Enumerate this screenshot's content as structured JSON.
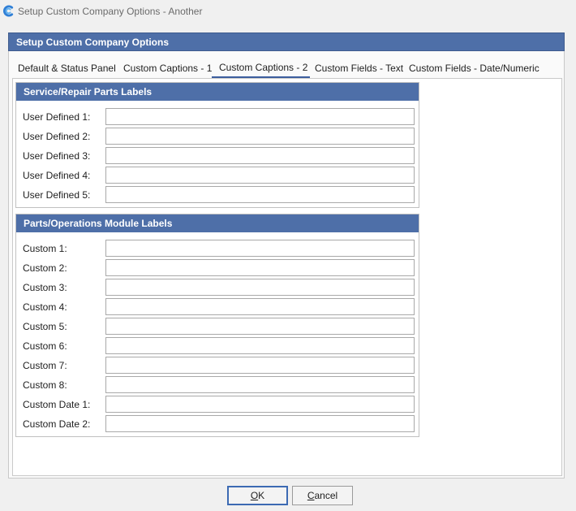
{
  "window": {
    "title": "Setup Custom Company Options - Another"
  },
  "dialog": {
    "header": "Setup Custom Company Options"
  },
  "tabs": [
    {
      "label": "Default & Status Panel"
    },
    {
      "label": "Custom Captions - 1"
    },
    {
      "label": "Custom Captions - 2",
      "active": true
    },
    {
      "label": "Custom Fields - Text"
    },
    {
      "label": "Custom Fields - Date/Numeric"
    }
  ],
  "service_group": {
    "title": "Service/Repair Parts Labels",
    "fields": [
      {
        "label": "User Defined 1:",
        "value": ""
      },
      {
        "label": "User Defined 2:",
        "value": ""
      },
      {
        "label": "User Defined 3:",
        "value": ""
      },
      {
        "label": "User Defined 4:",
        "value": ""
      },
      {
        "label": "User Defined 5:",
        "value": ""
      }
    ]
  },
  "parts_group": {
    "title": "Parts/Operations Module Labels",
    "fields": [
      {
        "label": "Custom 1:",
        "value": ""
      },
      {
        "label": "Custom 2:",
        "value": ""
      },
      {
        "label": "Custom 3:",
        "value": ""
      },
      {
        "label": "Custom 4:",
        "value": ""
      },
      {
        "label": "Custom 5:",
        "value": ""
      },
      {
        "label": "Custom 6:",
        "value": ""
      },
      {
        "label": "Custom 7:",
        "value": ""
      },
      {
        "label": "Custom 8:",
        "value": ""
      },
      {
        "label": "Custom Date 1:",
        "value": ""
      },
      {
        "label": "Custom Date 2:",
        "value": ""
      }
    ]
  },
  "buttons": {
    "ok": {
      "mnemonic": "O",
      "rest": "K"
    },
    "cancel": {
      "mnemonic": "C",
      "rest": "ancel"
    }
  },
  "colors": {
    "header_blue": "#4e6fa8",
    "accent": "#3c5e9e"
  }
}
